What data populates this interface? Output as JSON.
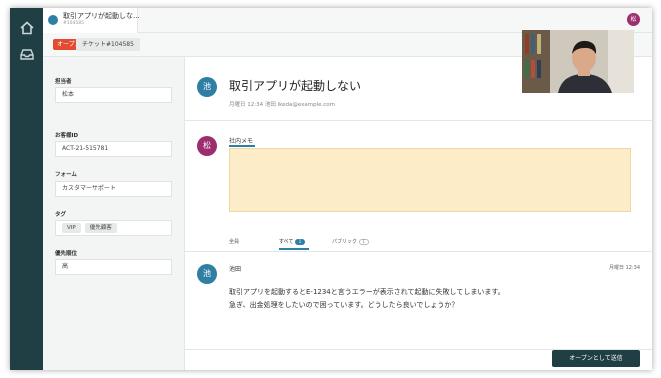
{
  "header": {
    "tab_title": "取引アプリが起動しな...",
    "tab_subtitle": "#104585",
    "user_initial": "松"
  },
  "ticket": {
    "status_badge": "オープン",
    "ticket_id": "チケット#104585"
  },
  "properties": {
    "assignee_label": "担当者",
    "assignee_value": "松本",
    "customer_id_label": "お客様ID",
    "customer_id_value": "ACT-21-515781",
    "form_label": "フォーム",
    "form_value": "カスタマーサポート",
    "tags_label": "タグ",
    "tags": [
      "VIP",
      "優先顧客"
    ],
    "priority_label": "優先順位",
    "priority_value": "高"
  },
  "conversation": {
    "requester_initial": "池",
    "subject": "取引アプリが起動しない",
    "meta": "月曜日 12:34 池田 ikeda@example.com",
    "agent_initial": "松",
    "memo_label": "社内メモ",
    "filters": {
      "all": "全員",
      "everyone": "すべて",
      "everyone_count": "1",
      "public": "パブリック",
      "public_count": "1"
    },
    "message": {
      "author_initial": "池",
      "author": "池田",
      "date": "月曜日 12:34",
      "line1": "取引アプリを起動するとE-1234と言うエラーが表示されて起動に失敗してしまいます。",
      "line2": "急ぎ、出金処理をしたいので困っています。どうしたら良いでしょうか？"
    }
  },
  "actions": {
    "submit_label": "オープンとして送信"
  },
  "colors": {
    "nav": "#1f3f44",
    "accent": "#2f7fa5",
    "memo_bg": "#fcecc7",
    "badge_red": "#e34a2f",
    "avatar_purple": "#9c2d6e"
  }
}
